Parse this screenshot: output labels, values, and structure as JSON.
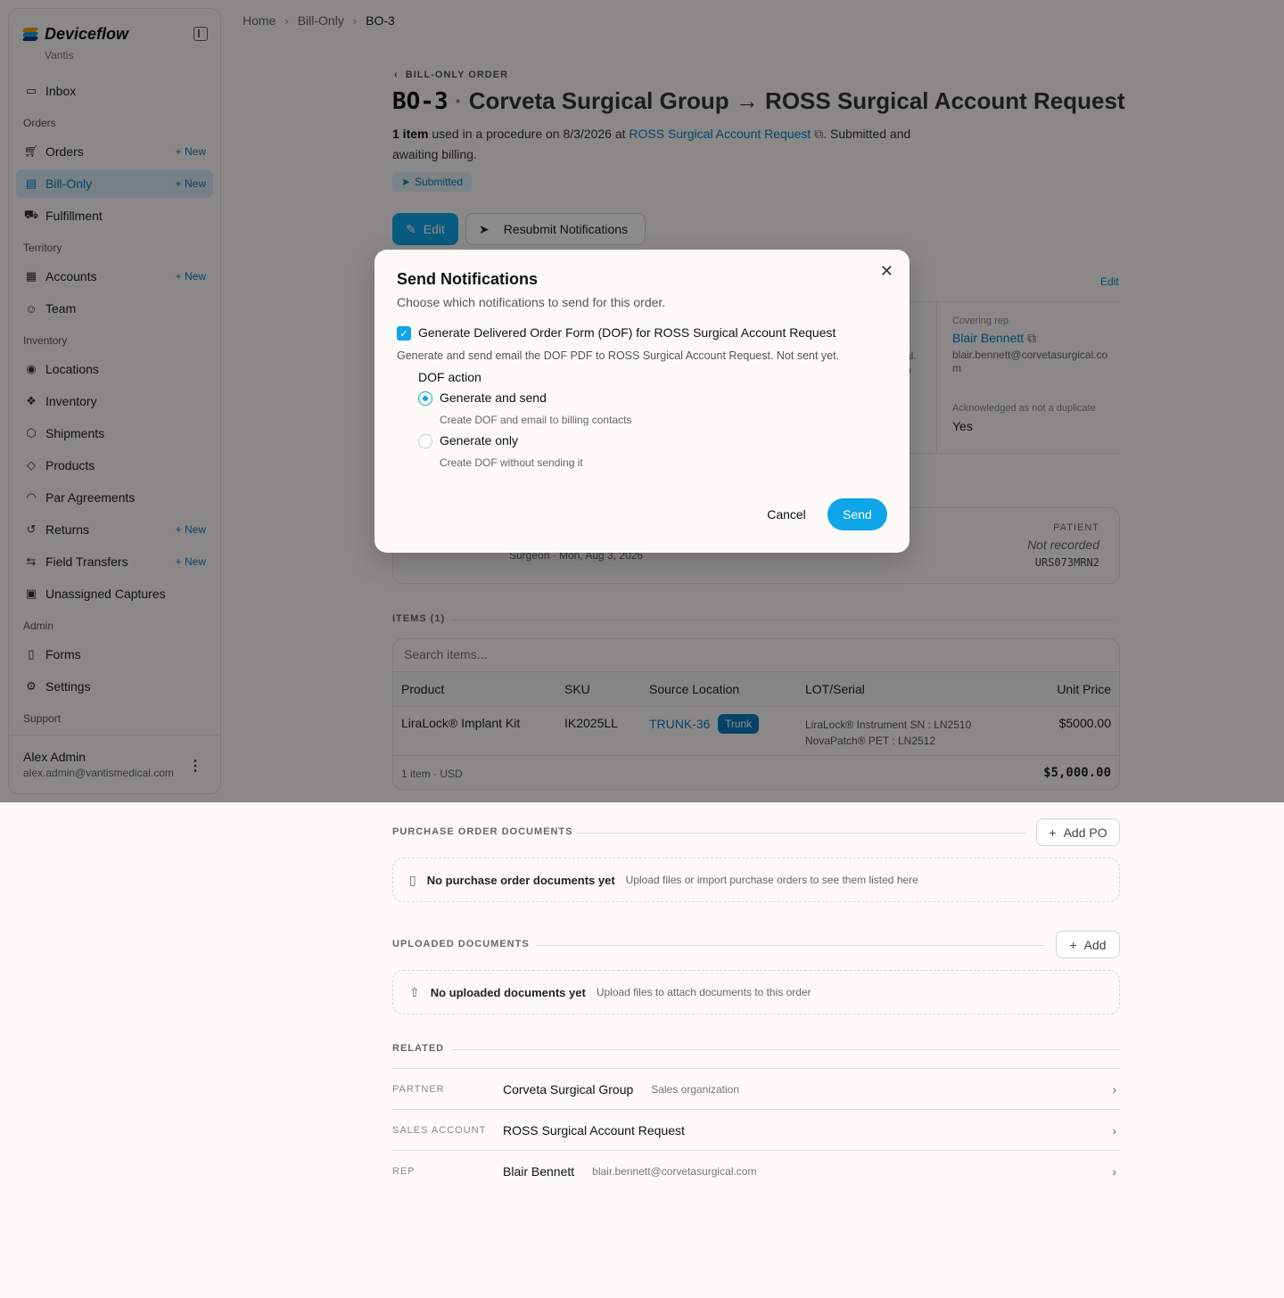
{
  "sidebar": {
    "brand": "Deviceflow",
    "org": "Vantis",
    "new_label": "+ New",
    "sections": {
      "orders": "Orders",
      "territory": "Territory",
      "inventory": "Inventory",
      "admin": "Admin",
      "support": "Support"
    },
    "items": {
      "inbox": "Inbox",
      "orders": "Orders",
      "bill_only": "Bill-Only",
      "fulfillment": "Fulfillment",
      "accounts": "Accounts",
      "team": "Team",
      "locations": "Locations",
      "inventory": "Inventory",
      "shipments": "Shipments",
      "products": "Products",
      "par_agreements": "Par Agreements",
      "returns": "Returns",
      "field_transfers": "Field Transfers",
      "unassigned_captures": "Unassigned Captures",
      "forms": "Forms",
      "settings": "Settings"
    },
    "user": {
      "name": "Alex Admin",
      "email": "alex.admin@vantismedical.com"
    }
  },
  "breadcrumb": [
    "Home",
    "Bill-Only",
    "BO-3"
  ],
  "header": {
    "back_label": "BILL-ONLY ORDER",
    "id": "BO-3",
    "title_rest": "Corveta Surgical Group → ROSS Surgical Account Request",
    "summary_count": "1 item",
    "summary_mid": " used in a procedure on 8/3/2026 at ",
    "summary_link": "ROSS Surgical Account Request",
    "summary_end": ". Submitted and awaiting billing.",
    "status": "Submitted",
    "edit_label": "Edit",
    "resubmit_label": "Resubmit Notifications"
  },
  "details": {
    "edit_label": "Edit",
    "covering_rep_label": "Covering rep",
    "covering_rep_name": "Blair Bennett",
    "covering_rep_email": "blair.bennett@corvetasurgical.com",
    "ack_label": "Acknowledged as not a duplicate",
    "ack_value": "Yes",
    "partial_left": "al.",
    "partial_left2": "o"
  },
  "procedure": {
    "sub": "Surgeon · Mon, Aug 3, 2026",
    "patient_label": "PATIENT",
    "patient_value": "Not recorded",
    "patient_id": "URS073MRN2"
  },
  "items": {
    "heading": "ITEMS (1)",
    "search_placeholder": "Search items...",
    "columns": [
      "Product",
      "SKU",
      "Source Location",
      "LOT/Serial",
      "Unit Price"
    ],
    "rows": [
      {
        "product": "LiraLock® Implant Kit",
        "sku": "IK2025LL",
        "location": "TRUNK-36",
        "location_badge": "Trunk",
        "lot1": "LiraLock® Instrument SN : LN2510",
        "lot2": "NovaPatch® PET : LN2512",
        "price": "$5000.00"
      }
    ],
    "footer_left": "1 item · USD",
    "footer_total": "$5,000.00"
  },
  "modal": {
    "title": "Send Notifications",
    "subtitle": "Choose which notifications to send for this order.",
    "checkbox_label": "Generate Delivered Order Form (DOF) for ROSS Surgical Account Request",
    "checkbox_desc": "Generate and send email the DOF PDF to ROSS Surgical Account Request. Not sent yet.",
    "dof_label": "DOF action",
    "options": [
      {
        "label": "Generate and send",
        "desc": "Create DOF and email to billing contacts",
        "checked": true
      },
      {
        "label": "Generate only",
        "desc": "Create DOF without sending it",
        "checked": false
      }
    ],
    "cancel_label": "Cancel",
    "send_label": "Send"
  },
  "po_docs": {
    "heading": "PURCHASE ORDER DOCUMENTS",
    "add_label": "Add PO",
    "empty_title": "No purchase order documents yet",
    "empty_desc": "Upload files or import purchase orders to see them listed here"
  },
  "uploaded_docs": {
    "heading": "UPLOADED DOCUMENTS",
    "add_label": "Add",
    "empty_title": "No uploaded documents yet",
    "empty_desc": "Upload files to attach documents to this order"
  },
  "related": {
    "heading": "RELATED",
    "rows": [
      {
        "label": "PARTNER",
        "name": "Corveta Surgical Group",
        "sub": "Sales organization"
      },
      {
        "label": "SALES ACCOUNT",
        "name": "ROSS Surgical Account Request",
        "sub": ""
      },
      {
        "label": "REP",
        "name": "Blair Bennett",
        "sub": "blair.bennett@corvetasurgical.com"
      }
    ]
  },
  "colors": {
    "accent": "#0ea5e9",
    "link": "#0b7bc0",
    "active_bg": "#d5eaf6"
  }
}
